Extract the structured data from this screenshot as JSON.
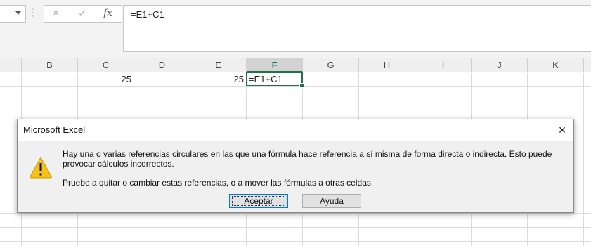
{
  "formula_bar": {
    "cancel_icon": "×",
    "enter_icon": "✓",
    "fx_label": "fx",
    "formula": "=E1+C1"
  },
  "columns": [
    "B",
    "C",
    "D",
    "E",
    "F",
    "G",
    "H",
    "I",
    "J",
    "K"
  ],
  "active_column": "F",
  "cells": {
    "C1": "25",
    "E1": "25",
    "F1": "=E1+C1"
  },
  "dialog": {
    "title": "Microsoft Excel",
    "close_icon": "×",
    "message_line1": "Hay una o varias referencias circulares en las que una fórmula hace referencia a sí misma de forma directa o indirecta. Esto puede provocar cálculos incorrectos.",
    "message_line2": "Pruebe a quitar o cambiar estas referencias, o a mover las fórmulas a otras celdas.",
    "accept_label": "Aceptar",
    "help_label": "Ayuda",
    "icon": "warning-icon",
    "warning_color": "#f6c21a"
  },
  "colors": {
    "excel_green": "#217346"
  }
}
